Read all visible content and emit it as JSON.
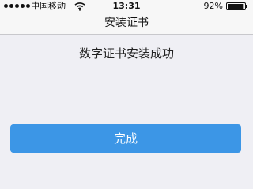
{
  "status_bar": {
    "carrier": "中国移动",
    "time": "13:31",
    "battery_percent": "92%",
    "battery_level": 0.92,
    "signal_bars": 5,
    "wifi_icon": "wifi-icon",
    "battery_icon": "battery-icon"
  },
  "nav": {
    "title": "安装证书"
  },
  "content": {
    "message": "数字证书安装成功"
  },
  "actions": {
    "done_label": "完成"
  },
  "colors": {
    "background": "#efeff4",
    "bar_background": "#f7f7f7",
    "primary_button": "#3c96e6",
    "button_text": "#ffffff"
  }
}
